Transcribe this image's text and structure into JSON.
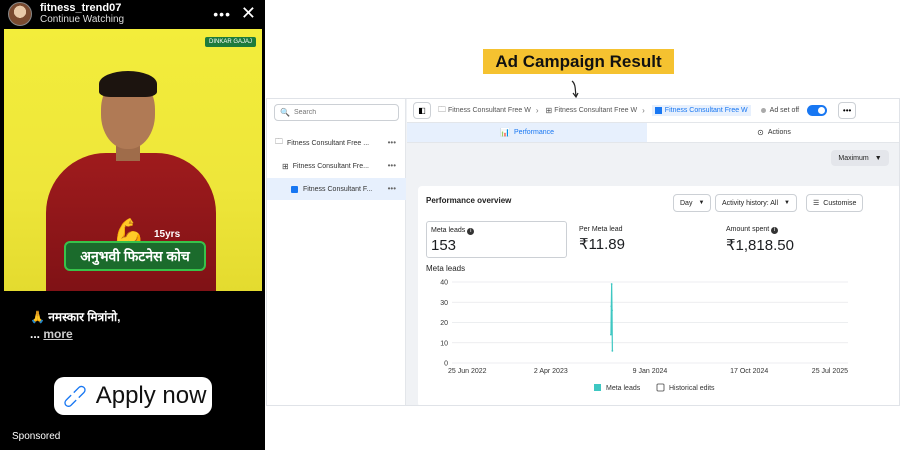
{
  "story": {
    "username": "fitness_trend07",
    "subtitle": "Continue Watching",
    "more_icon": "more-horizontal-icon",
    "close_icon": "close-icon",
    "video": {
      "brand_tag": "DINKAR GAJAJ",
      "years": "15yrs",
      "badge": "अनुभवी फिटनेस कोच"
    },
    "caption_line1": "🙏 नमस्कार मित्रांनो,",
    "caption_ellipsis": "...",
    "caption_more": "more",
    "cta_label": "Apply now",
    "cta_icon": "link-icon",
    "sponsored": "Sponsored"
  },
  "title": "Ad Campaign Result",
  "ads_manager": {
    "search_placeholder": "Search",
    "tree": [
      {
        "label": "Fitness Consultant Free ...",
        "icon": "folder-icon"
      },
      {
        "label": "Fitness Consultant Fre...",
        "icon": "grid-icon"
      },
      {
        "label": "Fitness Consultant F...",
        "icon": "ad-icon"
      }
    ],
    "breadcrumbs": [
      {
        "label": "Fitness Consultant Free W"
      },
      {
        "label": "Fitness Consultant Free W"
      },
      {
        "label": "Fitness Consultant Free W"
      }
    ],
    "adset_status": "Ad set off",
    "tabs": {
      "performance": "Performance",
      "actions": "Actions"
    },
    "maximum": "Maximum",
    "card": {
      "title": "Performance overview",
      "day_select": "Day",
      "activity": "Activity history: All",
      "customise": "Customise",
      "metrics": [
        {
          "label": "Meta leads",
          "value": "153"
        },
        {
          "label": "Per Meta lead",
          "value": "₹11.89"
        },
        {
          "label": "Amount spent",
          "value": "₹1,818.50"
        }
      ],
      "chart_title": "Meta leads"
    }
  },
  "chart_data": {
    "type": "line",
    "title": "Meta leads",
    "x_ticks": [
      "25 Jun 2022",
      "2 Apr 2023",
      "9 Jan 2024",
      "17 Oct 2024",
      "25 Jul 2025"
    ],
    "y_ticks": [
      0,
      10,
      20,
      30,
      40
    ],
    "ylim": [
      0,
      40
    ],
    "series": [
      {
        "name": "Meta leads",
        "color": "#3ec7c2",
        "x": [
          "2023-09-20",
          "2023-09-21",
          "2023-09-22",
          "2023-09-23",
          "2023-09-24"
        ],
        "values": [
          14,
          28,
          39,
          26,
          6
        ]
      }
    ],
    "legend": [
      "Meta leads",
      "Historical edits"
    ],
    "legend_position": "bottom"
  }
}
